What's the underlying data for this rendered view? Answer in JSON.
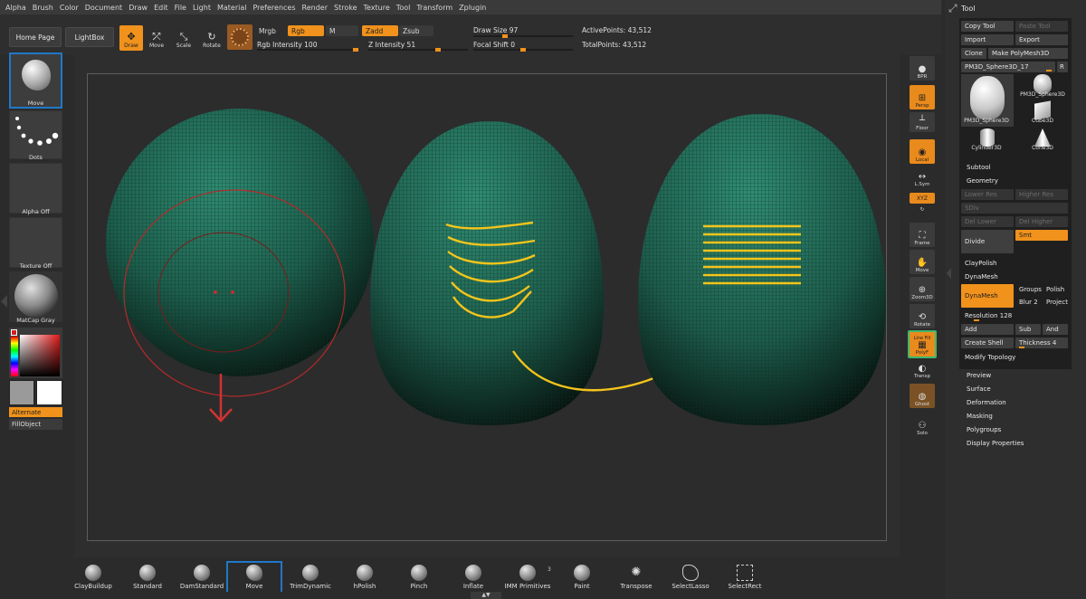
{
  "menu": [
    "Alpha",
    "Brush",
    "Color",
    "Document",
    "Draw",
    "Edit",
    "File",
    "Light",
    "Material",
    "Preferences",
    "Render",
    "Stroke",
    "Texture",
    "Tool",
    "Transform",
    "Zplugin"
  ],
  "shelf": {
    "home": "Home Page",
    "lightbox": "LightBox",
    "modes": [
      "Draw",
      "Move",
      "Scale",
      "Rotate"
    ],
    "mrgb": "Mrgb",
    "rgb": "Rgb",
    "m": "M",
    "zadd": "Zadd",
    "zsub": "Zsub",
    "rgb_intensity": "Rgb Intensity 100",
    "z_intensity": "Z Intensity 51",
    "draw_size": "Draw Size 97",
    "focal_shift": "Focal Shift 0",
    "active_points": "ActivePoints: 43,512",
    "total_points": "TotalPoints: 43,512"
  },
  "left": {
    "brush": "Move",
    "stroke": "Dots",
    "alpha": "Alpha Off",
    "texture": "Texture Off",
    "material": "MatCap Gray",
    "alternate": "Alternate",
    "fillobject": "FillObject"
  },
  "right_shelf": [
    "BPR",
    "Persp",
    "Floor",
    "Local",
    "L.Sym",
    "Frame",
    "Move",
    "Zoom3D",
    "Rotate",
    "PolyF",
    "Transp",
    "Ghost",
    "Solo"
  ],
  "right_shelf_small": {
    "xyz": "XYZ",
    "linefill": "Line Fill"
  },
  "tool": {
    "title": "Tool",
    "copy": "Copy Tool",
    "paste": "Paste Tool",
    "import": "Import",
    "export": "Export",
    "clone": "Clone",
    "make_polymesh": "Make PolyMesh3D",
    "current": "PM3D_Sphere3D_17",
    "r": "R",
    "thumbs": [
      "PM3D_Sphere3D",
      "PM3D_Sphere3D",
      "Cube3D",
      "Cylinder3D",
      "Cone3D"
    ],
    "subtool": "Subtool",
    "geometry": "Geometry",
    "lower_res": "Lower Res",
    "higher_res": "Higher Res",
    "sdiv": "SDiv",
    "del_lower": "Del Lower",
    "del_higher": "Del Higher",
    "divide": "Divide",
    "smt": "Smt",
    "claypolish": "ClayPolish",
    "dynamesh_header": "DynaMesh",
    "dynamesh": "DynaMesh",
    "groups": "Groups",
    "polish": "Polish",
    "blur": "Blur 2",
    "project": "Project",
    "resolution": "Resolution 128",
    "add": "Add",
    "sub": "Sub",
    "and": "And",
    "create_shell": "Create Shell",
    "thickness": "Thickness 4",
    "modify_topology": "Modify Topology",
    "sections": [
      "Preview",
      "Surface",
      "Deformation",
      "Masking",
      "Polygroups",
      "Display Properties"
    ]
  },
  "bottom_brushes": [
    "ClayBuildup",
    "Standard",
    "DamStandard",
    "Move",
    "TrimDynamic",
    "hPolish",
    "Pinch",
    "Inflate",
    "IMM Primitives",
    "Paint",
    "Transpose",
    "SelectLasso",
    "SelectRect"
  ],
  "imm_count": "3",
  "colors": {
    "accent": "#f0921c",
    "mesh": "#1d5a4a",
    "stroke_yellow": "#f3c41b",
    "brush_circle": "#b32a2a",
    "highlight_blue": "#1f78c8"
  }
}
